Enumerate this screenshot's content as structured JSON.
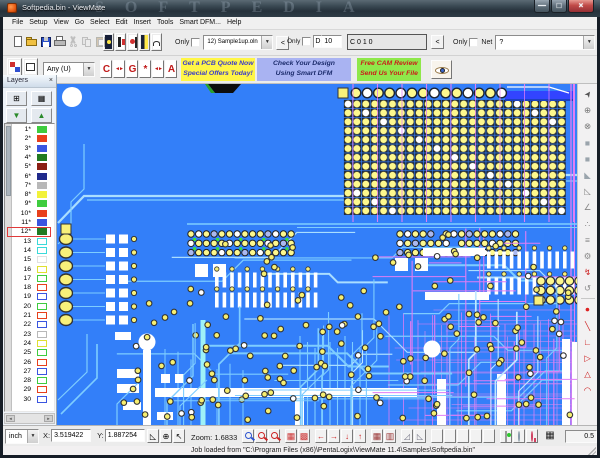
{
  "window": {
    "title": "Softpedia.bin - ViewMate",
    "watermark": "SOFTPEDIA",
    "caption": {
      "minimize": "—",
      "maximize": "□",
      "close": "×"
    }
  },
  "menu_items": [
    "File",
    "Setup",
    "View",
    "Go",
    "Select",
    "Edit",
    "Insert",
    "Tools",
    "Smart DFM...",
    "Help"
  ],
  "toolbar_main": {
    "only_layer_label": "Only",
    "layer_combo_value": "12) Sample1up.oln",
    "layer_prev_button": "<",
    "only_dcode_label": "Only",
    "d_label": "D",
    "d_value": "10",
    "dcode_info_value": "C 0 1 0",
    "dcode_prev_button": "<",
    "only_net_label": "Only",
    "net_label": "Net",
    "net_combo_value": "?"
  },
  "toolbar_modes": {
    "shape_combo_value": "Any    (U)",
    "letter_buttons": [
      "C",
      "◄►",
      "G",
      "*",
      "◄►",
      "A"
    ],
    "banners": [
      {
        "line1": "Get a PCB Quote Now",
        "line2": "Special Offers Today!",
        "bg": "#fff646",
        "fg": "#3a3acc"
      },
      {
        "line1": "Check Your Design",
        "line2": "Using Smart DFM",
        "bg": "#a9b3f2",
        "fg": "#1a2a6a"
      },
      {
        "line1": "Free CAM Review",
        "line2": "Send Us Your File",
        "bg": "#8fe84a",
        "fg": "#cc1a1a"
      }
    ]
  },
  "layers_panel": {
    "title": "Layers",
    "close": "×",
    "rows": [
      {
        "num": "1*",
        "color": "#3ecc3e",
        "filled": true
      },
      {
        "num": "2*",
        "color": "#e8401c",
        "filled": true
      },
      {
        "num": "3*",
        "color": "#3a55e0",
        "filled": true
      },
      {
        "num": "4*",
        "color": "#217a21",
        "filled": true
      },
      {
        "num": "5*",
        "color": "#8b1f14",
        "filled": true
      },
      {
        "num": "6*",
        "color": "#202a8b",
        "filled": true
      },
      {
        "num": "7*",
        "color": "#b8b8b8",
        "filled": true
      },
      {
        "num": "8*",
        "color": "#f2f23a",
        "filled": true
      },
      {
        "num": "9*",
        "color": "#3ecc3e",
        "filled": true
      },
      {
        "num": "10*",
        "color": "#e8401c",
        "filled": true
      },
      {
        "num": "11*",
        "color": "#3a55e0",
        "filled": true
      },
      {
        "num": "12*",
        "color": "#217a21",
        "filled": true,
        "selected": true
      },
      {
        "num": "13",
        "color": "#3adada",
        "filled": false
      },
      {
        "num": "14",
        "color": "#3adada",
        "filled": false
      },
      {
        "num": "15",
        "color": "#e0e0e0",
        "filled": false
      },
      {
        "num": "16",
        "color": "#e0e030",
        "filled": false
      },
      {
        "num": "17",
        "color": "#3ecc3e",
        "filled": false
      },
      {
        "num": "18",
        "color": "#e8401c",
        "filled": false
      },
      {
        "num": "19",
        "color": "#3a55e0",
        "filled": false
      },
      {
        "num": "20",
        "color": "#3ecc3e",
        "filled": false
      },
      {
        "num": "21",
        "color": "#e8401c",
        "filled": false
      },
      {
        "num": "22",
        "color": "#3a55e0",
        "filled": false
      },
      {
        "num": "23",
        "color": "#b8b8b8",
        "filled": false
      },
      {
        "num": "24",
        "color": "#e0e030",
        "filled": false
      },
      {
        "num": "25",
        "color": "#3ecc3e",
        "filled": false
      },
      {
        "num": "26",
        "color": "#e8401c",
        "filled": false
      },
      {
        "num": "27",
        "color": "#3a55e0",
        "filled": false
      },
      {
        "num": "28",
        "color": "#3ecc3e",
        "filled": false
      },
      {
        "num": "29",
        "color": "#e8401c",
        "filled": false
      },
      {
        "num": "30",
        "color": "#3a55e0",
        "filled": false
      }
    ]
  },
  "right_tools": [
    {
      "name": "select-arrow-icon",
      "glyph": "➤",
      "color": "#555",
      "rot": -55
    },
    {
      "name": "pad-insert-icon",
      "glyph": "⊕",
      "color": "#777"
    },
    {
      "name": "pad-insert-2-icon",
      "glyph": "⊗",
      "color": "#777"
    },
    {
      "name": "rect-filled-icon",
      "glyph": "■",
      "color": "#9aa4ac"
    },
    {
      "name": "rect-filled-2-icon",
      "glyph": "■",
      "color": "#9aa4ac"
    },
    {
      "name": "triangle-filled-icon",
      "glyph": "◣",
      "color": "#9aa4ac"
    },
    {
      "name": "triangle-outline-icon",
      "glyph": "◺",
      "color": "#888"
    },
    {
      "name": "angle-icon",
      "glyph": "∠",
      "color": "#888"
    },
    {
      "name": "dots-icon",
      "glyph": "∴",
      "color": "#888"
    },
    {
      "name": "steps-icon",
      "glyph": "≡",
      "color": "#888"
    },
    {
      "name": "gear-icon",
      "glyph": "⚙",
      "color": "#888"
    },
    {
      "name": "break-icon",
      "glyph": "↯",
      "color": "#cc2222"
    },
    {
      "name": "undo-icon",
      "glyph": "↺",
      "color": "#888"
    },
    {
      "name": "divider",
      "glyph": "",
      "color": ""
    },
    {
      "name": "dot-red-icon",
      "glyph": "●",
      "color": "#dd2222"
    },
    {
      "name": "line-tool-icon",
      "glyph": "╲",
      "color": "#cc2222"
    },
    {
      "name": "corner-tool-icon",
      "glyph": "∟",
      "color": "#cc2222"
    },
    {
      "name": "triangle-right-icon",
      "glyph": "▷",
      "color": "#cc2222"
    },
    {
      "name": "triangle-tool-icon",
      "glyph": "△",
      "color": "#cc2222"
    },
    {
      "name": "arc-tool-icon",
      "glyph": "◠",
      "color": "#cc2222"
    }
  ],
  "status_toolbar": {
    "unit_value": "inch",
    "x_label": "X:",
    "x_value": "3.519422",
    "y_label": "Y:",
    "y_value": "1.887254",
    "zoom_label": "Zoom: 1.6833",
    "scale_value": "0.5"
  },
  "statusbar": {
    "message": "Job loaded from \"C:\\Program Files (x86)\\PentaLogix\\ViewMate 11.4\\Samples\\Softpedia.bin\""
  },
  "canvas": {
    "bg": "#337ff9",
    "trace_cyan": "#7ecdff",
    "trace_cyan_light": "#aadeff",
    "trace_cyan_wide": "#9ef1f7",
    "trace_magenta": "#e07df5",
    "pad_yellow": "#f8f07a",
    "pad_ring": "#2a2a3a",
    "bga_pad": "#fdf88d",
    "bga_cell": "#1d2532",
    "strip_blue": "#3244ff",
    "component_white": "#ffffff",
    "green_dot": "#3ae03a"
  }
}
